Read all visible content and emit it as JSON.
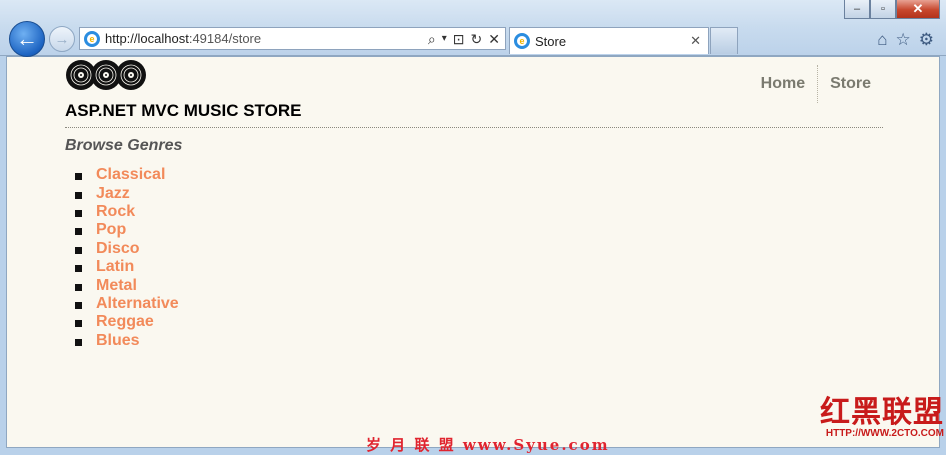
{
  "browser": {
    "url_host": "http://localhost",
    "url_rest": ":49184/store",
    "tab_title": "Store",
    "tab_close": "✕",
    "nav_back": "←",
    "nav_forward": "→",
    "addr_tools": [
      "⌕",
      "▾",
      "⊡",
      "↻",
      "✕"
    ],
    "toolbar_icons": [
      "home-icon",
      "star-icon",
      "gear-icon"
    ],
    "toolbar_glyphs": [
      "⌂",
      "☆",
      "⚙"
    ],
    "win_buttons": [
      "–",
      "▫",
      "✕"
    ]
  },
  "site": {
    "title": "ASP.NET MVC MUSIC STORE",
    "nav": [
      {
        "label": "Home"
      },
      {
        "label": "Store"
      }
    ]
  },
  "main": {
    "heading": "Browse Genres",
    "genres": [
      "Classical",
      "Jazz",
      "Rock",
      "Pop",
      "Disco",
      "Latin",
      "Metal",
      "Alternative",
      "Reggae",
      "Blues"
    ]
  },
  "watermarks": {
    "bottom": "岁 月 联 盟  www.Syue.com",
    "corner_big": "红黑联盟",
    "corner_small": "HTTP://WWW.2CTO.COM"
  },
  "colors": {
    "link": "#f28a5a",
    "page_bg": "#faf8f0",
    "nav_text": "#7a7a6f"
  }
}
